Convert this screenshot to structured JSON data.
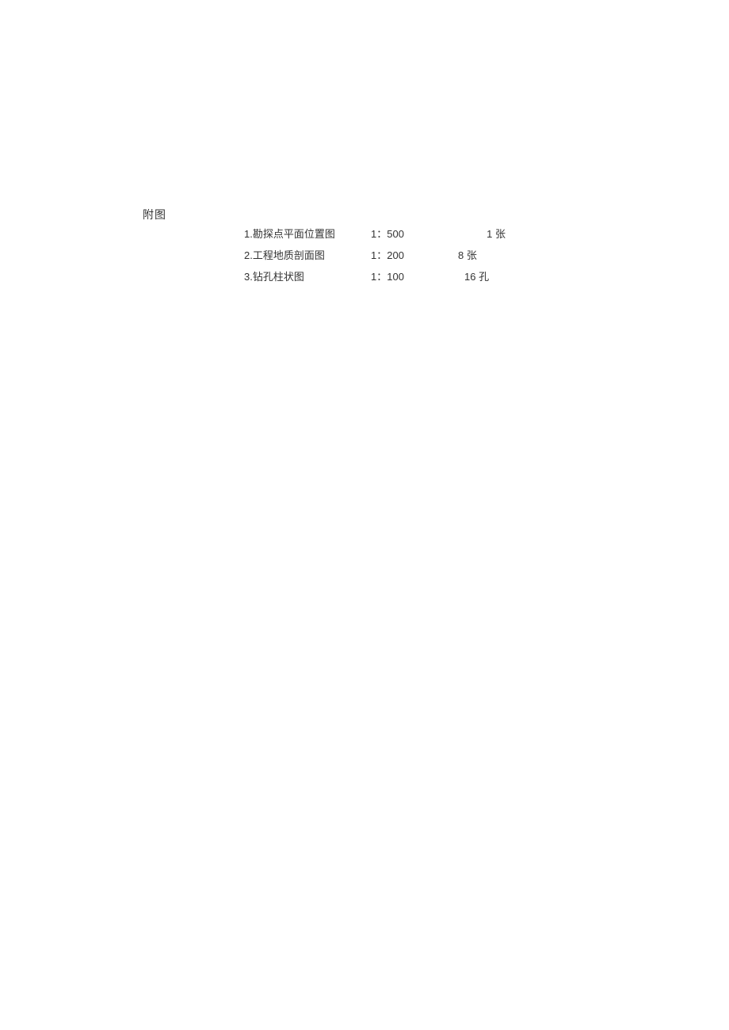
{
  "section_label": "附图",
  "attachments": [
    {
      "name": "1.勘探点平面位置图",
      "scale": "1：500",
      "count": "1 张"
    },
    {
      "name": "2.工程地质剖面图",
      "scale": "1：200",
      "count": "8 张"
    },
    {
      "name": "3.钻孔柱状图",
      "scale": "1：100",
      "count": "16 孔"
    }
  ]
}
